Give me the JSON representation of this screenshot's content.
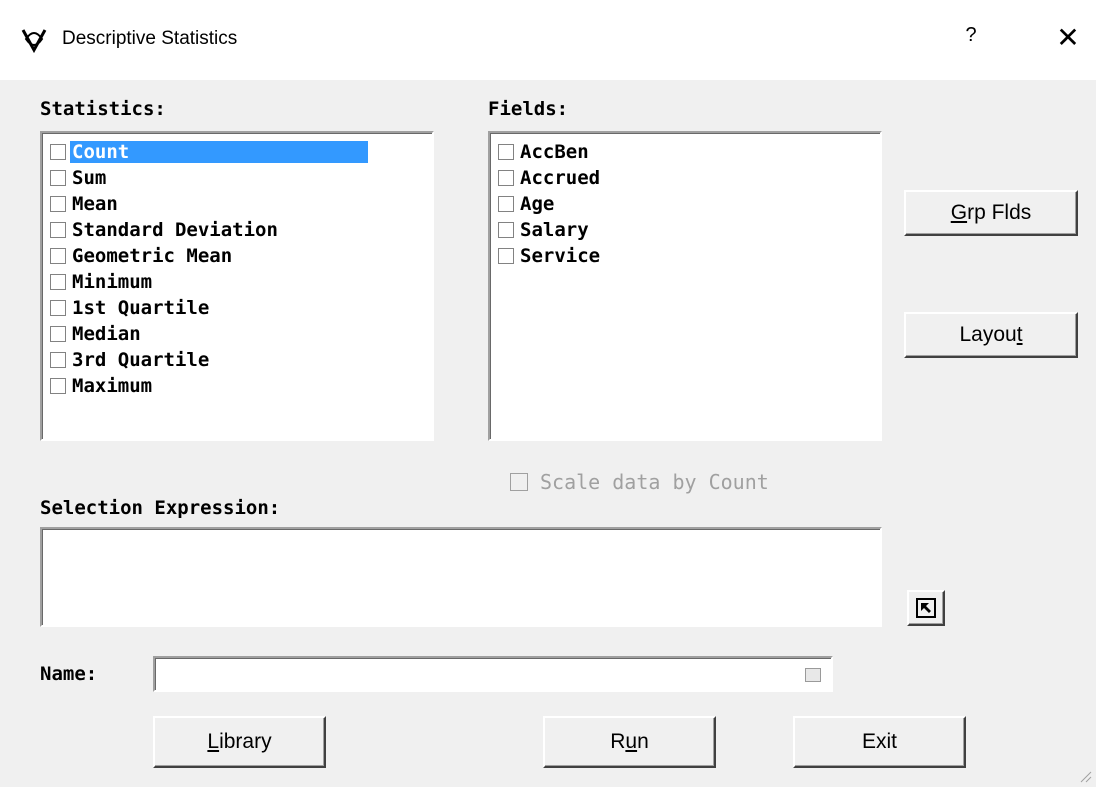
{
  "window": {
    "title": "Descriptive Statistics",
    "help_label": "?",
    "close_label": "✕"
  },
  "statistics": {
    "label": "Statistics:",
    "items": [
      "Count",
      "Sum",
      "Mean",
      "Standard Deviation",
      "Geometric Mean",
      "Minimum",
      "1st Quartile",
      "Median",
      "3rd Quartile",
      "Maximum"
    ],
    "selected": "Count"
  },
  "fields": {
    "label": "Fields:",
    "items": [
      "AccBen",
      "Accrued",
      "Age",
      "Salary",
      "Service"
    ]
  },
  "buttons": {
    "grp_flds": {
      "pre": "",
      "u": "G",
      "post": "rp Flds"
    },
    "layout": {
      "pre": "Layou",
      "u": "t",
      "post": ""
    },
    "library": {
      "pre": "",
      "u": "L",
      "post": "ibrary"
    },
    "run": {
      "pre": "R",
      "u": "u",
      "post": "n"
    },
    "exit": {
      "pre": "Exit",
      "u": "",
      "post": ""
    }
  },
  "scale_data": {
    "label": "Scale data by Count",
    "checked": false,
    "enabled": false
  },
  "selection_expression": {
    "label": "Selection Expression:",
    "value": ""
  },
  "name": {
    "label": "Name:",
    "value": ""
  },
  "colors": {
    "selection": "#3399ff",
    "dialog_bg": "#f0f0f0"
  },
  "icons": {
    "app": "app-logo-icon",
    "expr_builder": "arrow-up-left-icon",
    "name_picker": "pick-icon",
    "grip": "resize-grip-icon"
  }
}
